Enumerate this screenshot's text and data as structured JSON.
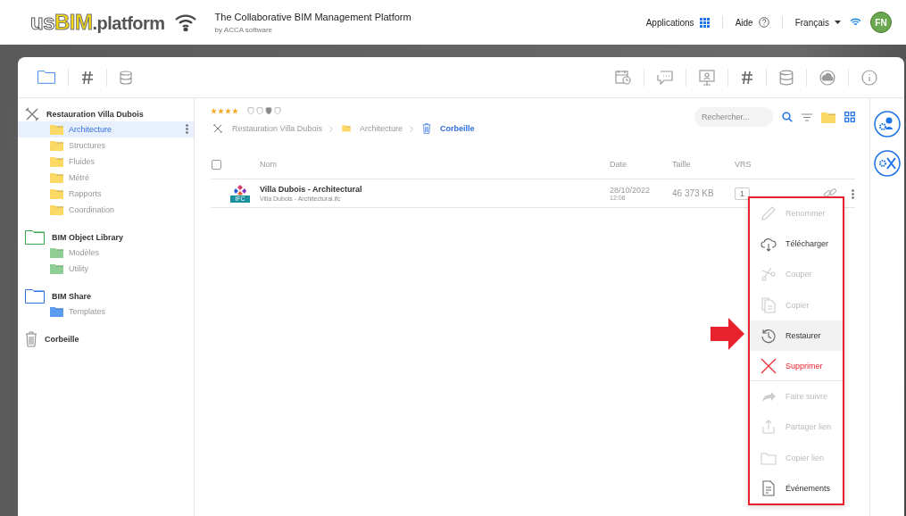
{
  "header": {
    "logo": {
      "prefix": "us",
      "highlight": "BIM",
      "suffix": ".platform"
    },
    "title": "The Collaborative BIM Management Platform",
    "subtitle": "by ACCA software",
    "applications": "Applications",
    "help": "Aide",
    "language": "Français",
    "avatar": "FN"
  },
  "sidebar": {
    "groups": [
      {
        "name": "Restauration Villa Dubois",
        "kind": "project",
        "children": [
          {
            "label": "Architecture",
            "selected": true,
            "kind": "folder"
          },
          {
            "label": "Structures",
            "selected": false,
            "kind": "folder"
          },
          {
            "label": "Fluides",
            "selected": false,
            "kind": "folder"
          },
          {
            "label": "Métré",
            "selected": false,
            "kind": "folder"
          },
          {
            "label": "Rapports",
            "selected": false,
            "kind": "folder"
          },
          {
            "label": "Coordination",
            "selected": false,
            "kind": "folder"
          }
        ]
      },
      {
        "name": "BIM Object Library",
        "kind": "library",
        "children": [
          {
            "label": "Modèles",
            "selected": false,
            "kind": "library"
          },
          {
            "label": "Utility",
            "selected": false,
            "kind": "library"
          }
        ]
      },
      {
        "name": "BIM Share",
        "kind": "share",
        "children": [
          {
            "label": "Templates",
            "selected": false,
            "kind": "share"
          }
        ]
      },
      {
        "name": "Corbeille",
        "kind": "trash"
      }
    ]
  },
  "content": {
    "stars": 4,
    "breadcrumb": [
      {
        "label": "Restauration Villa Dubois",
        "kind": "project",
        "selected": false
      },
      {
        "label": "Architecture",
        "kind": "folder",
        "selected": false
      },
      {
        "label": "Corbeille",
        "kind": "trash",
        "selected": true
      }
    ],
    "search": {
      "placeholder": "Rechercher..."
    },
    "table": {
      "select_all": {
        "checked": false
      },
      "columns": [
        "Nom",
        "Date",
        "Taille",
        "VRS"
      ],
      "rows": [
        {
          "name": "Villa Dubois - Architectural",
          "file": "Villa Dubois - Architectural.ifc",
          "badge": "IFC",
          "date": "28/10/2022",
          "time": "12:08",
          "size": "46 373 KB",
          "vrs": "1"
        }
      ]
    }
  },
  "context_menu": [
    {
      "label": "Renommer",
      "kind": "rename",
      "disabled": true,
      "selected": false
    },
    {
      "label": "Télécharger",
      "kind": "download",
      "disabled": false,
      "selected": false
    },
    {
      "label": "Couper",
      "kind": "cut",
      "disabled": true,
      "selected": false
    },
    {
      "label": "Copier",
      "kind": "copy",
      "disabled": true,
      "selected": false
    },
    {
      "label": "Restaurer",
      "kind": "restore",
      "disabled": false,
      "selected": true
    },
    {
      "label": "Supprimer",
      "kind": "delete",
      "disabled": false,
      "selected": false
    },
    {
      "label": "Faire suivre",
      "kind": "forward",
      "disabled": true,
      "selected": false
    },
    {
      "label": "Partager lien",
      "kind": "share",
      "disabled": true,
      "selected": false
    },
    {
      "label": "Copier lien",
      "kind": "copylink",
      "disabled": true,
      "selected": false
    },
    {
      "label": "Événements",
      "kind": "events",
      "disabled": false,
      "selected": false
    }
  ]
}
